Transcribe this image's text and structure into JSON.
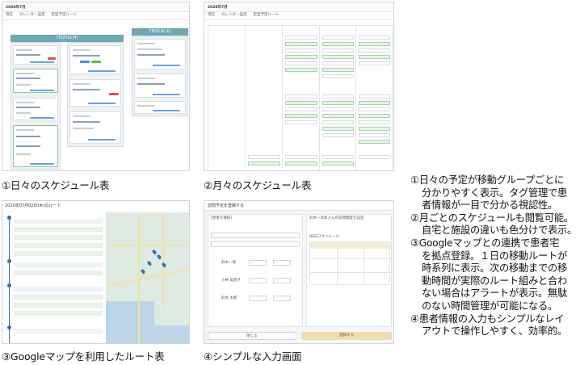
{
  "screens": {
    "daily": {
      "caption": "①日々のスケジュール表",
      "toolbar": {
        "period": "2020年7月",
        "tab1": "現在",
        "tab2": "カレンダー設定",
        "tab3": "定型予定ルール"
      },
      "day1": "7月20日(月)",
      "day2": "7月21日(火)"
    },
    "monthly": {
      "caption": "②月々のスケジュール表",
      "toolbar": {
        "period": "2020年7月",
        "tab1": "現在",
        "tab2": "カレンダー設定",
        "tab3": "定型予定ルール"
      }
    },
    "route": {
      "caption": "③Googleマップを利用したルート表",
      "title": "2020年07月02日(木)のルート"
    },
    "input": {
      "caption": "④シンプルな入力画面",
      "title": "訪問予定を登録する",
      "section": "[患者を選択]",
      "right_title": "鈴木一太郎さんの訪問頻度を設定",
      "schedule_label": "WEBスケジュール",
      "cancel_label": "閉じる",
      "submit_label": "登録する",
      "patients": [
        "鈴木一郎",
        "小林 美恵子",
        "鈴木 太郎"
      ]
    }
  },
  "description": {
    "lines": [
      "①日々の予定が移動グループごとに",
      "分かりやすく表示。タグ管理で患",
      "者情報が一目で分かる視認性。",
      "②月ごとのスケジュールも閲覧可能。",
      "自宅と施設の違いも色分けで表示。",
      "③Googleマップとの連携で患者宅",
      "を拠点登録。１日の移動ルートが",
      "時系列に表示。次の移動までの移",
      "動時間が実際のルート組みと合わ",
      "ない場合はアラートが表示。無駄",
      "のない時間管理が可能になる。",
      "④患者情報の入力もシンプルなレイ",
      "アウトで操作しやすく、効率的。"
    ]
  }
}
